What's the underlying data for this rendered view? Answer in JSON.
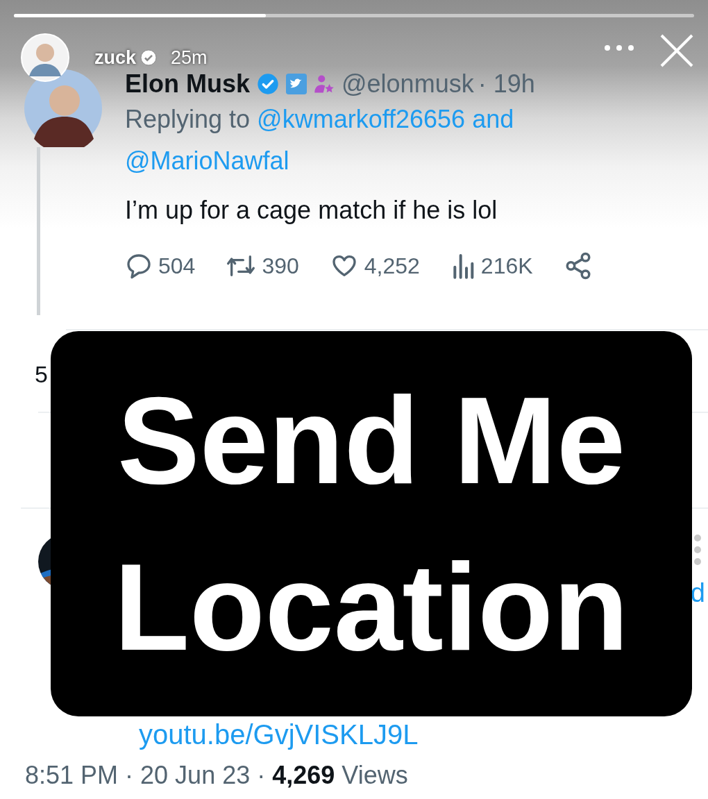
{
  "story": {
    "progress": {
      "level": 0.37
    },
    "user": "zuck",
    "verified": true,
    "time": "25m"
  },
  "tweet": {
    "author": "Elon Musk",
    "verified": true,
    "handle": "@elonmusk",
    "time": "· 19h",
    "reply_prefix": "Replying to",
    "reply_links": [
      "@kwmarkoff26656 and",
      "@MarioNawfal"
    ],
    "text": "I’m up for a cage match if he is lol",
    "stats": [
      {
        "kind": "reply",
        "count": "504"
      },
      {
        "kind": "retweet",
        "count": "390"
      },
      {
        "kind": "like",
        "count": "4,252"
      },
      {
        "kind": "views",
        "count": "216K"
      },
      {
        "kind": "share"
      }
    ]
  },
  "below": {
    "left_fragment": "5",
    "right_fragment": "d",
    "link": "youtu.be/GvjVISKLJ9L",
    "footer": "8:51 PM · 20 Jun 23 · **4,269** Views"
  },
  "sticker": {
    "text": "Send Me Location"
  }
}
